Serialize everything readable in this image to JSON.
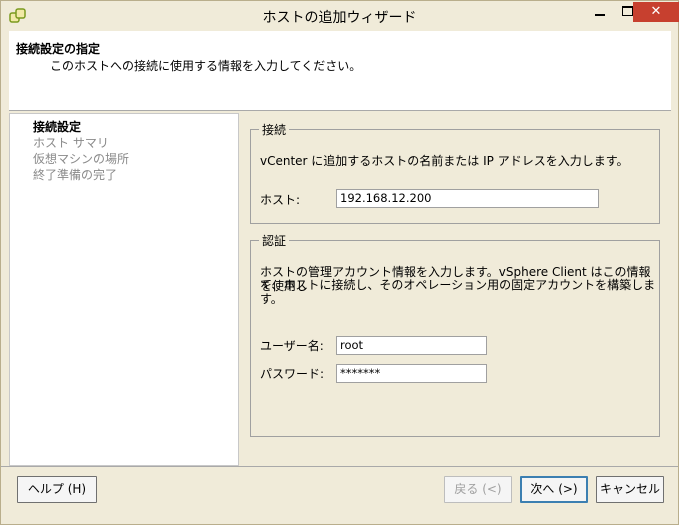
{
  "window": {
    "title": "ホストの追加ウィザード",
    "icon": "vsphere-add-host-icon",
    "controls": {
      "minimize": "",
      "maximize": "",
      "close": "✕"
    }
  },
  "header": {
    "title": "接続設定の指定",
    "subtitle": "このホストへの接続に使用する情報を入力してください。"
  },
  "steps": [
    {
      "label": "接続設定",
      "active": true
    },
    {
      "label": "ホスト サマリ",
      "active": false
    },
    {
      "label": "仮想マシンの場所",
      "active": false
    },
    {
      "label": "終了準備の完了",
      "active": false
    }
  ],
  "connection": {
    "legend": "接続",
    "description": "vCenter に追加するホストの名前または IP アドレスを入力します。",
    "host_label": "ホスト:",
    "host_value": "192.168.12.200"
  },
  "auth": {
    "legend": "認証",
    "description_line1": "ホストの管理アカウント情報を入力します。vSphere Client はこの情報を使用し",
    "description_line2": "て、ホストに接続し、そのオペレーション用の固定アカウントを構築します。",
    "username_label": "ユーザー名:",
    "username_value": "root",
    "password_label": "パスワード:",
    "password_value": "*******"
  },
  "buttons": {
    "help": "ヘルプ (H)",
    "back": "戻る (<)",
    "next": "次へ (>)",
    "cancel": "キャンセル"
  },
  "colors": {
    "window_bg": "#f0ebd9",
    "close_button": "#c7402f",
    "default_button_border": "#3c7fb1"
  }
}
